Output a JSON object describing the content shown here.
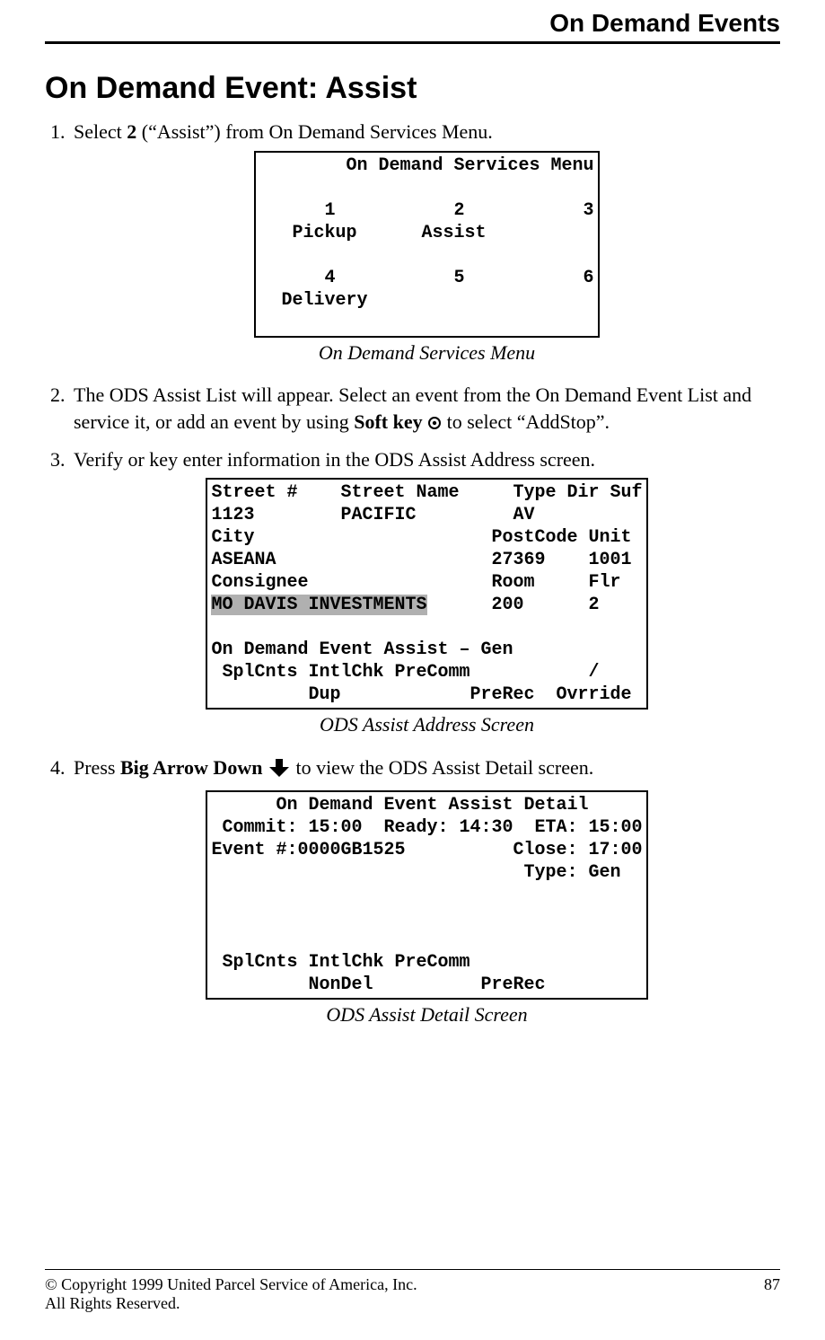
{
  "header": "On Demand Events",
  "title": "On Demand Event: Assist",
  "steps": {
    "s1a": "Select ",
    "s1b": "2",
    "s1c": " (“Assist”) from On Demand Services Menu.",
    "s2a": "The ODS Assist List will appear. Select an event from the On Demand Event List and service it, or add an event by using ",
    "s2b": "Soft key",
    "s2c": " to select “AddStop”.",
    "s3": "Verify or key enter information in the ODS Assist Address screen.",
    "s4a": "Press ",
    "s4b": "Big Arrow Down",
    "s4c": " to view the ODS Assist Detail screen."
  },
  "screen1": {
    "line1": "        On Demand Services Menu",
    "line2": "",
    "line3": "      1           2           3",
    "line4": "   Pickup      Assist",
    "line5": "",
    "line6": "      4           5           6",
    "line7": "  Delivery",
    "line8": "",
    "line9": ""
  },
  "caption1": "On Demand Services Menu",
  "screen2": {
    "line1": "Street #    Street Name     Type Dir Suf",
    "line2": "1123        PACIFIC         AV",
    "line3": "City                      PostCode Unit",
    "line4": "ASEANA                    27369    1001",
    "line5": "Consignee                 Room     Flr",
    "hl": "MO DAVIS INVESTMENTS",
    "line6b": "      200      2",
    "line7": "",
    "line8": "On Demand Event Assist – Gen",
    "line9": " SplCnts IntlChk PreComm           /",
    "line10": "         Dup            PreRec  Ovrride"
  },
  "caption2": "ODS Assist Address Screen",
  "screen3": {
    "line1": "      On Demand Event Assist Detail",
    "line2": " Commit: 15:00  Ready: 14:30  ETA: 15:00",
    "line3": "Event #:0000GB1525          Close: 17:00",
    "line4": "                             Type: Gen",
    "line5": "",
    "line6": "",
    "line7": "",
    "line8": " SplCnts IntlChk PreComm",
    "line9": "         NonDel          PreRec"
  },
  "caption3": "ODS Assist Detail Screen",
  "footer": {
    "copyright_line1": "© Copyright 1999 United Parcel Service of America, Inc.",
    "copyright_line2": "All Rights Reserved.",
    "page_number": "87"
  }
}
